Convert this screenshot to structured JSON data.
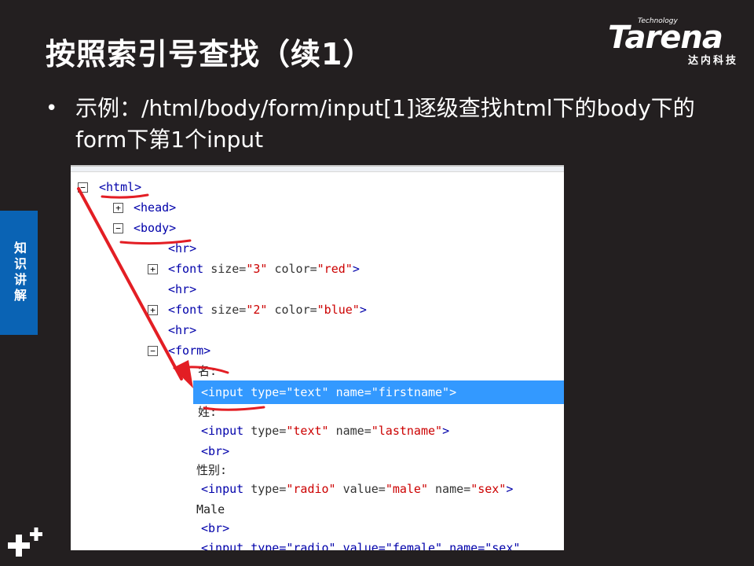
{
  "slide": {
    "title": "按照索引号查找（续1）",
    "bullet": "示例：/html/body/form/input[1]逐级查找html下的body下的form下第1个input",
    "side_tab": "知识讲解"
  },
  "logo": {
    "small": "Technology",
    "main": "Tarena",
    "cn": "达内科技"
  },
  "tree": {
    "html": "<html>",
    "head": "<head>",
    "body": "<body>",
    "hr1": "<hr>",
    "font1_tag": "<font ",
    "font1_attr1": "size=",
    "font1_val1": "\"3\"",
    "font1_attr2": " color=",
    "font1_val2": "\"red\"",
    "font1_end": ">",
    "hr2": "<hr>",
    "font2_tag": "<font ",
    "font2_attr1": "size=",
    "font2_val1": "\"2\"",
    "font2_attr2": " color=",
    "font2_val2": "\"blue\"",
    "font2_end": ">",
    "hr3": "<hr>",
    "form": "<form>",
    "ming": "名:",
    "input1": "<input type=\"text\" name=\"firstname\">",
    "xing": "姓:",
    "input2_tag": "<input ",
    "input2_attr1": "type=",
    "input2_val1": "\"text\"",
    "input2_attr2": " name=",
    "input2_val2": "\"lastname\"",
    "input2_end": ">",
    "br1": "<br>",
    "xingbie": "性别:",
    "input3_tag": "<input ",
    "input3_attr1": "type=",
    "input3_val1": "\"radio\"",
    "input3_attr2": " value=",
    "input3_val2": "\"male\"",
    "input3_attr3": " name=",
    "input3_val3": "\"sex\"",
    "input3_end": ">",
    "male": "Male",
    "br2": "<br>",
    "input4_partial": "<input type=\"radio\" value=\"female\" name=\"sex\""
  }
}
